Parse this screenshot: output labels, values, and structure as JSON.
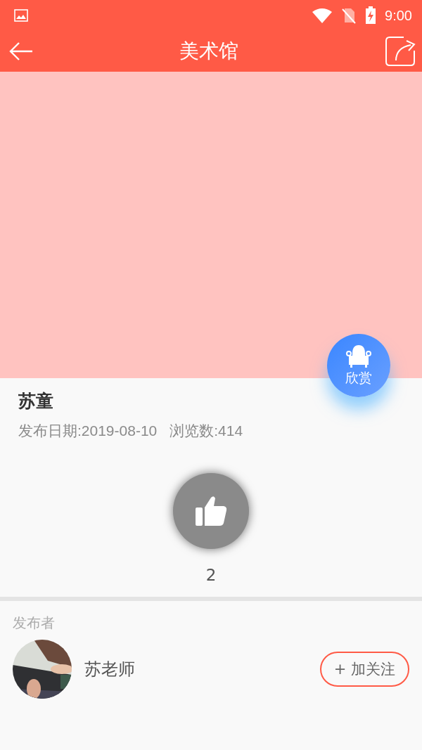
{
  "status_bar": {
    "time": "9:00"
  },
  "header": {
    "title": "美术馆"
  },
  "artwork": {
    "title": "苏童",
    "publish_date": "发布日期:2019-08-10",
    "views": "浏览数:414",
    "appreciate_label": "欣赏"
  },
  "like": {
    "liked": false,
    "count": "2"
  },
  "publisher": {
    "section_label": "发布者",
    "name": "苏老师",
    "follow_button": "+ 加关注"
  }
}
